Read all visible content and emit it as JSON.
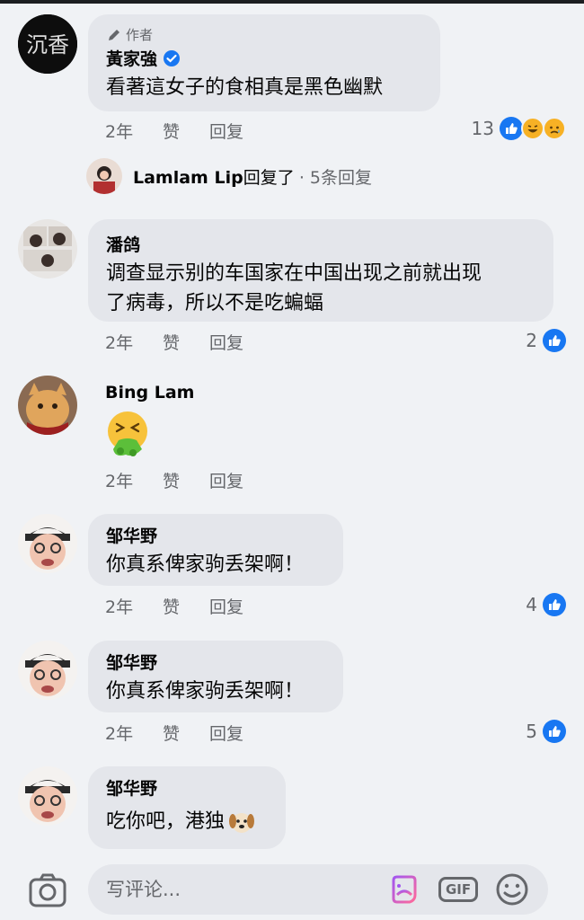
{
  "comments": [
    {
      "author_badge": "作者",
      "author": "黃家強",
      "text": "看著這女子的食相真是黑色幽默",
      "time": "2年",
      "like": "赞",
      "reply": "回复",
      "reaction_count": "13",
      "avatar_text": "沉香"
    },
    {
      "author": "潘鸽",
      "text_line1": "调查显示别的车国家在中国出现之前就出现",
      "text_line2": "了病毒，所以不是吃蝙蝠",
      "time": "2年",
      "like": "赞",
      "reply": "回复",
      "reaction_count": "2"
    },
    {
      "author": "Bing Lam",
      "time": "2年",
      "like": "赞",
      "reply": "回复"
    },
    {
      "author": "邹华野",
      "text": "你真系俾家驹丢架啊！",
      "time": "2年",
      "like": "赞",
      "reply": "回复",
      "reaction_count": "4"
    },
    {
      "author": "邹华野",
      "text": "你真系俾家驹丢架啊！",
      "time": "2年",
      "like": "赞",
      "reply": "回复",
      "reaction_count": "5"
    },
    {
      "author": "邹华野",
      "text": "吃你吧，港独"
    }
  ],
  "reply_summary": {
    "name": "Lamlam Lip",
    "action": "回复了",
    "count": "· 5条回复"
  },
  "composer": {
    "placeholder": "写评论...",
    "gif_label": "GIF"
  },
  "colors": {
    "background": "#f0f2f5",
    "bubble": "#e4e6eb",
    "like_blue": "#1877f2",
    "muted_text": "#65676b"
  }
}
